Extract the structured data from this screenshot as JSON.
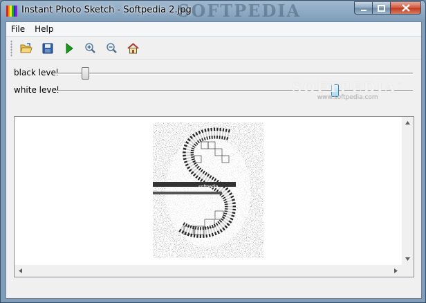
{
  "window": {
    "title": "Instant Photo Sketch - Softpedia 2.jpg",
    "watermark": "SOFTPEDIA"
  },
  "menu": {
    "items": [
      {
        "label": "File"
      },
      {
        "label": "Help"
      }
    ]
  },
  "toolbar": {
    "buttons": [
      {
        "icon": "open-folder-icon"
      },
      {
        "icon": "save-icon"
      },
      {
        "icon": "play-icon"
      },
      {
        "icon": "zoom-in-icon"
      },
      {
        "icon": "zoom-out-icon"
      },
      {
        "icon": "home-icon"
      }
    ]
  },
  "sliders": {
    "black": {
      "label": "black level",
      "value": 0.08
    },
    "white": {
      "label": "white level",
      "value": 0.79
    }
  },
  "watermark": {
    "brand": "SOFTPEDIA",
    "tm": "™",
    "url": "www.softpedia.com"
  },
  "image": {
    "overlay_text": "softpedia"
  },
  "colors": {
    "accent": "#3c7fb1",
    "play": "#1a9a1a",
    "close": "#c23a1d"
  }
}
